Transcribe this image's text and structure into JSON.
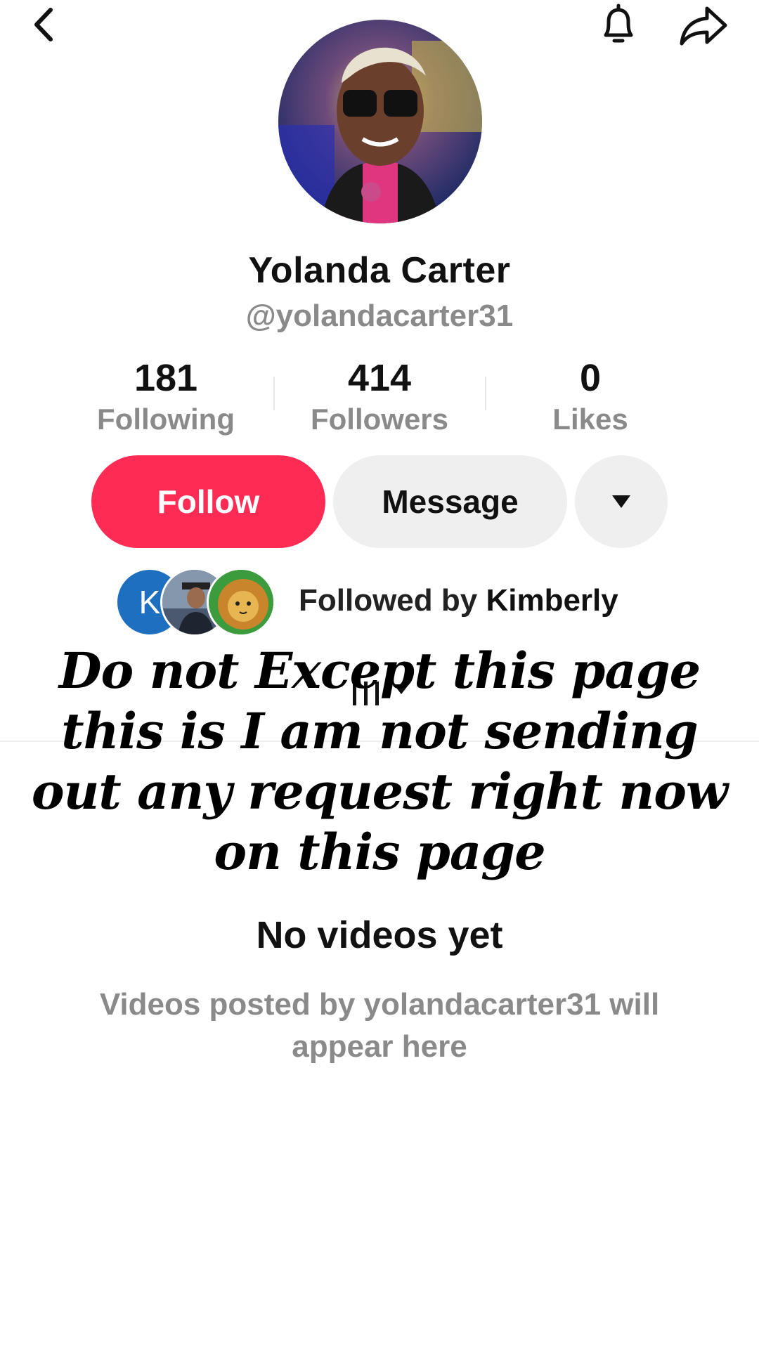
{
  "header": {
    "back_icon": "chevron-left-icon",
    "bell_icon": "bell-icon",
    "share_icon": "share-icon"
  },
  "profile": {
    "name": "Yolanda Carter",
    "handle": "@yolandacarter31",
    "avatar": "profile-photo"
  },
  "stats": {
    "following_count": "181",
    "following_label": "Following",
    "followers_count": "414",
    "followers_label": "Followers",
    "likes_count": "0",
    "likes_label": "Likes"
  },
  "actions": {
    "follow_label": "Follow",
    "message_label": "Message",
    "more_icon": "caret-down-icon"
  },
  "mutual": {
    "prefix": "Followed by ",
    "name": "Kimberly",
    "k_initial": "K"
  },
  "overlay": {
    "text": "Do not Except this page this is I am not sending out any request right now on this page"
  },
  "empty_state": {
    "title": "No videos yet",
    "description": "Videos posted by yolandacarter31 will appear here"
  },
  "colors": {
    "accent": "#fe2c55",
    "muted_text": "#8a8a8a",
    "button_bg": "#efefef"
  }
}
